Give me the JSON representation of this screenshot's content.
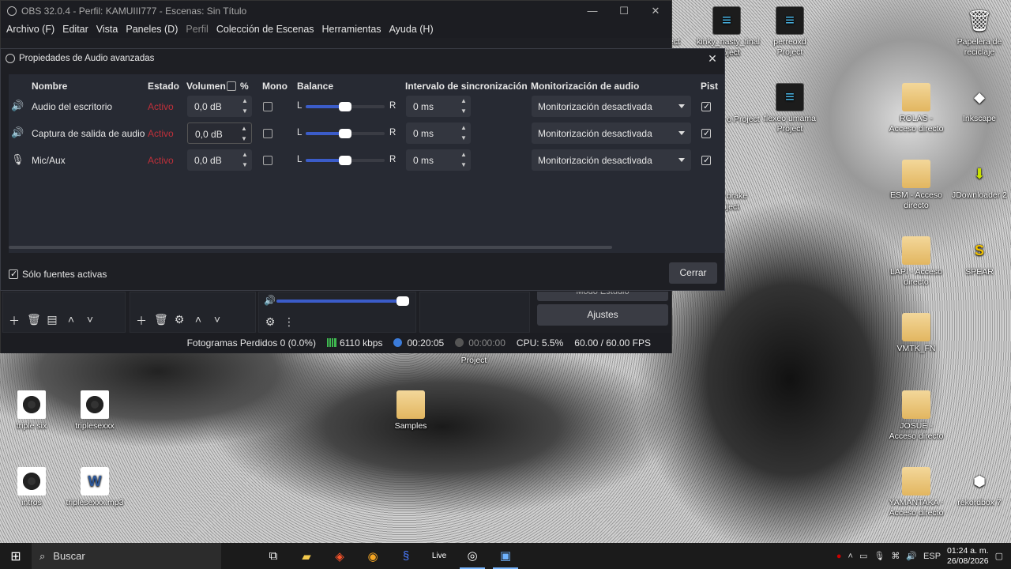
{
  "desktop": {
    "icons": [
      {
        "label": "kinky_nasty_final Project",
        "type": "project"
      },
      {
        "label": "perreoxd Project",
        "type": "project"
      },
      {
        "label": "Papelera de reciclaje",
        "type": "recycle"
      },
      {
        "label": "flexeo umama Project",
        "type": "project"
      },
      {
        "label": "ROLAS - Acceso directo",
        "type": "folder"
      },
      {
        "label": "Inkscape",
        "type": "app"
      },
      {
        "label": "ESM - Acceso directo",
        "type": "folder"
      },
      {
        "label": "JDownloader 2",
        "type": "app"
      },
      {
        "label": "LAPI - Acceso directo",
        "type": "folder"
      },
      {
        "label": "SPEAR",
        "type": "app"
      },
      {
        "label": "VMTK_FN",
        "type": "folder"
      },
      {
        "label": "JOSUE - Acceso directo",
        "type": "folder"
      },
      {
        "label": "YAMANTAKA - Acceso directo",
        "type": "folder"
      },
      {
        "label": "rekordbox 7",
        "type": "app"
      },
      {
        "label": "triple six",
        "type": "audio"
      },
      {
        "label": "triplesexxx",
        "type": "audio"
      },
      {
        "label": "Samples",
        "type": "folder"
      },
      {
        "label": "intros",
        "type": "audio"
      },
      {
        "label": "triplesexxx.mp3",
        "type": "word"
      }
    ],
    "partial_labels": [
      "ect",
      "oject",
      "o Project",
      "brake",
      "oject",
      "Project"
    ]
  },
  "obs": {
    "title": "OBS 32.0.4 - Perfil: KAMUIII777 - Escenas: Sin Título",
    "menu": [
      "Archivo (F)",
      "Editar",
      "Vista",
      "Paneles (D)",
      "Perfil",
      "Colección de Escenas",
      "Herramientas",
      "Ayuda (H)"
    ],
    "menu_disabled": "Perfil",
    "controls": {
      "studio_mode": "Modo Estudio",
      "settings": "Ajustes"
    },
    "status": {
      "dropped_frames": "Fotogramas Perdidos 0 (0.0%)",
      "bitrate": "6110 kbps",
      "stream_time": "00:20:05",
      "rec_time": "00:00:00",
      "cpu": "CPU: 5.5%",
      "fps": "60.00 / 60.00 FPS"
    }
  },
  "dialog": {
    "title": "Propiedades de Audio avanzadas",
    "headers": {
      "name": "Nombre",
      "state": "Estado",
      "volume": "Volumen",
      "percent": "%",
      "mono": "Mono",
      "balance": "Balance",
      "sync": "Intervalo de sincronización",
      "monitoring": "Monitorización de audio",
      "tracks": "Pist"
    },
    "rows": [
      {
        "name": "Audio del escritorio",
        "state": "Activo",
        "volume": "0,0 dB",
        "mono": false,
        "balance_left": "L",
        "balance_right": "R",
        "balance": 0.5,
        "sync": "0 ms",
        "monitoring": "Monitorización desactivada",
        "track": true,
        "icon": "speaker-icon"
      },
      {
        "name": "Captura de salida de audio",
        "state": "Activo",
        "volume": "0,0 dB",
        "mono": false,
        "balance_left": "L",
        "balance_right": "R",
        "balance": 0.5,
        "sync": "0 ms",
        "monitoring": "Monitorización desactivada",
        "track": true,
        "icon": "speaker-icon"
      },
      {
        "name": "Mic/Aux",
        "state": "Activo",
        "volume": "0,0 dB",
        "mono": false,
        "balance_left": "L",
        "balance_right": "R",
        "balance": 0.5,
        "sync": "0 ms",
        "monitoring": "Monitorización desactivada",
        "track": true,
        "icon": "microphone-icon"
      }
    ],
    "only_active_label": "Sólo fuentes activas",
    "only_active": true,
    "close_label": "Cerrar"
  },
  "taskbar": {
    "search_placeholder": "Buscar",
    "language": "ESP",
    "time": "01:24 a. m.",
    "date": "26/08/2026"
  },
  "colors": {
    "accent": "#3b5cc9",
    "active_state": "#c0303a",
    "panel": "#272a33"
  }
}
